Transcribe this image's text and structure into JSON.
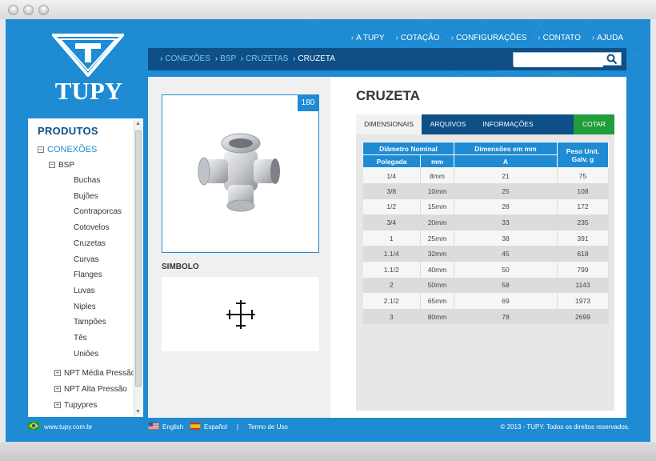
{
  "brand": {
    "name": "TUPY"
  },
  "topnav": [
    "A TUPY",
    "COTAÇÃO",
    "CONFIGURAÇÕES",
    "CONTATO",
    "AJUDA"
  ],
  "breadcrumb": {
    "items": [
      "CONEXÕES",
      "BSP",
      "CRUZETAS"
    ],
    "current": "CRUZETA"
  },
  "search": {
    "placeholder": "",
    "icon": "search-icon"
  },
  "sidebar": {
    "title": "PRODUTOS",
    "root": "CONEXÕES",
    "group": "BSP",
    "items": [
      "Buchas",
      "Bujões",
      "Contraporcas",
      "Cotovelos",
      "Cruzetas",
      "Curvas",
      "Flanges",
      "Luvas",
      "Niples",
      "Tampões",
      "Tês",
      "Uniões"
    ],
    "collapsed": [
      "NPT Média Pressão",
      "NPT Alta Pressão",
      "Tupypres"
    ]
  },
  "product": {
    "title": "CRUZETA",
    "code": "180",
    "symbol_label": "SIMBOLO"
  },
  "tabs": [
    "DIMENSIONAIS",
    "ARQUIVOS",
    "INFORMAÇÕES",
    "COTAR"
  ],
  "table": {
    "header_top": [
      "Diâmetro Nominal",
      "Dimensões em mm",
      "Peso Unit. Galv. g"
    ],
    "header_sub": [
      "Polegada",
      "mm",
      "A"
    ],
    "rows": [
      [
        "1/4",
        "8mm",
        "21",
        "75"
      ],
      [
        "3/8",
        "10mm",
        "25",
        "108"
      ],
      [
        "1/2",
        "15mm",
        "28",
        "172"
      ],
      [
        "3/4",
        "20mm",
        "33",
        "235"
      ],
      [
        "1",
        "25mm",
        "38",
        "391"
      ],
      [
        "1.1/4",
        "32mm",
        "45",
        "618"
      ],
      [
        "1.1/2",
        "40mm",
        "50",
        "799"
      ],
      [
        "2",
        "50mm",
        "58",
        "1143"
      ],
      [
        "2.1/2",
        "65mm",
        "69",
        "1973"
      ],
      [
        "3",
        "80mm",
        "78",
        "2699"
      ]
    ]
  },
  "footer": {
    "site": "www.tupy.com.br",
    "english": "English",
    "espanol": "Español",
    "sep": "|",
    "terms": "Termo de Uso",
    "copyright": "© 2013 - TUPY. Todos os direitos reservados."
  },
  "colors": {
    "primary": "#1e8bd3",
    "dark": "#0d4f86",
    "cotar": "#1f9e3a"
  }
}
